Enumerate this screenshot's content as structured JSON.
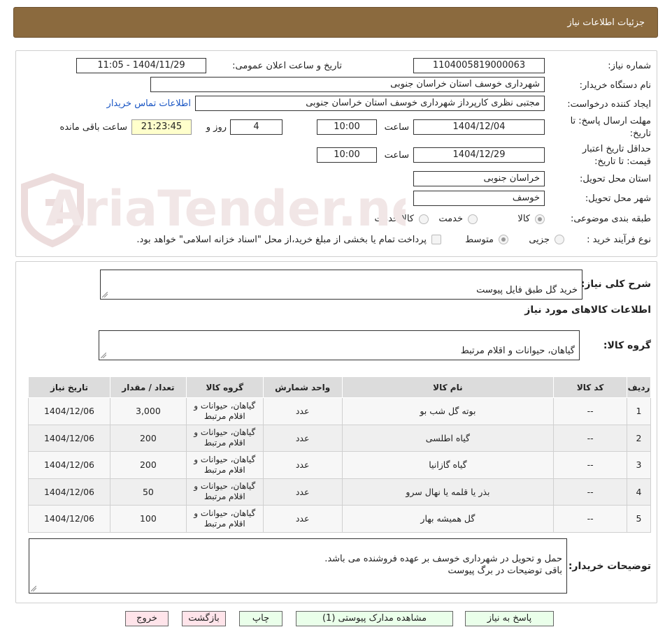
{
  "header": {
    "title": "جزئیات اطلاعات نیاز"
  },
  "form": {
    "need_number_label": "شماره نیاز:",
    "need_number": "1104005819000063",
    "announce_label": "تاریخ و ساعت اعلان عمومی:",
    "announce_value": "1404/11/29 - 11:05",
    "buyer_org_label": "نام دستگاه خریدار:",
    "buyer_org": "شهرداری خوسف استان خراسان جنوبی",
    "creator_label": "ایجاد کننده درخواست:",
    "creator": "مجتبی نظری کارپرداز شهرداری خوسف استان خراسان جنوبی",
    "contact_link": "اطلاعات تماس خریدار",
    "deadline_label": "مهلت ارسال پاسخ: تا تاریخ:",
    "deadline_date": "1404/12/04",
    "time_label": "ساعت",
    "deadline_time": "10:00",
    "days_value": "4",
    "days_label": "روز و",
    "remaining_time": "21:23:45",
    "remaining_label": "ساعت باقی مانده",
    "validity_label": "حداقل تاریخ اعتبار قیمت: تا تاریخ:",
    "validity_date": "1404/12/29",
    "validity_time": "10:00",
    "province_label": "استان محل تحویل:",
    "province": "خراسان جنوبی",
    "city_label": "شهر محل تحویل:",
    "city": "خوسف",
    "category_label": "طبقه بندی موضوعی:",
    "category_options": [
      "کالا",
      "خدمت",
      "کالا/خدمت"
    ],
    "process_label": "نوع فرآیند خرید :",
    "process_options": [
      "جزیی",
      "متوسط"
    ],
    "payment_note": "پرداخت تمام یا بخشی از مبلغ خرید،از محل \"اسناد خزانه اسلامی\" خواهد بود."
  },
  "details": {
    "summary_label": "شرح کلی نیاز:",
    "summary": "خرید گل طبق فایل پیوست",
    "goods_info_title": "اطلاعات کالاهای مورد نیاز",
    "group_label": "گروه کالا:",
    "group_value": "گیاهان، حیوانات و اقلام مرتبط",
    "table_headers": [
      "ردیف",
      "کد کالا",
      "نام کالا",
      "واحد شمارش",
      "گروه کالا",
      "تعداد / مقدار",
      "تاریخ نیاز"
    ],
    "rows": [
      {
        "n": "1",
        "code": "--",
        "name": "بوته گل شب بو",
        "unit": "عدد",
        "group": "گیاهان، حیوانات و اقلام مرتبط",
        "qty": "3,000",
        "date": "1404/12/06"
      },
      {
        "n": "2",
        "code": "--",
        "name": "گیاه اطلسی",
        "unit": "عدد",
        "group": "گیاهان، حیوانات و اقلام مرتبط",
        "qty": "200",
        "date": "1404/12/06"
      },
      {
        "n": "3",
        "code": "--",
        "name": "گیاه گازانیا",
        "unit": "عدد",
        "group": "گیاهان، حیوانات و اقلام مرتبط",
        "qty": "200",
        "date": "1404/12/06"
      },
      {
        "n": "4",
        "code": "--",
        "name": "بذر یا قلمه یا نهال سرو",
        "unit": "عدد",
        "group": "گیاهان، حیوانات و اقلام مرتبط",
        "qty": "50",
        "date": "1404/12/06"
      },
      {
        "n": "5",
        "code": "--",
        "name": "گل همیشه بهار",
        "unit": "عدد",
        "group": "گیاهان، حیوانات و اقلام مرتبط",
        "qty": "100",
        "date": "1404/12/06"
      }
    ],
    "buyer_notes_label": "توضیحات خریدار:",
    "buyer_notes": "حمل و تحویل در شهرداری خوسف بر عهده فروشنده می باشد.\nباقی توضیحات در برگ پیوست"
  },
  "buttons": {
    "reply": "پاسخ به نیاز",
    "attachments": "مشاهده مدارک پیوستی (1)",
    "print": "چاپ",
    "back": "بازگشت",
    "exit": "خروج"
  },
  "watermark": {
    "text": "AriaTender.neT"
  }
}
